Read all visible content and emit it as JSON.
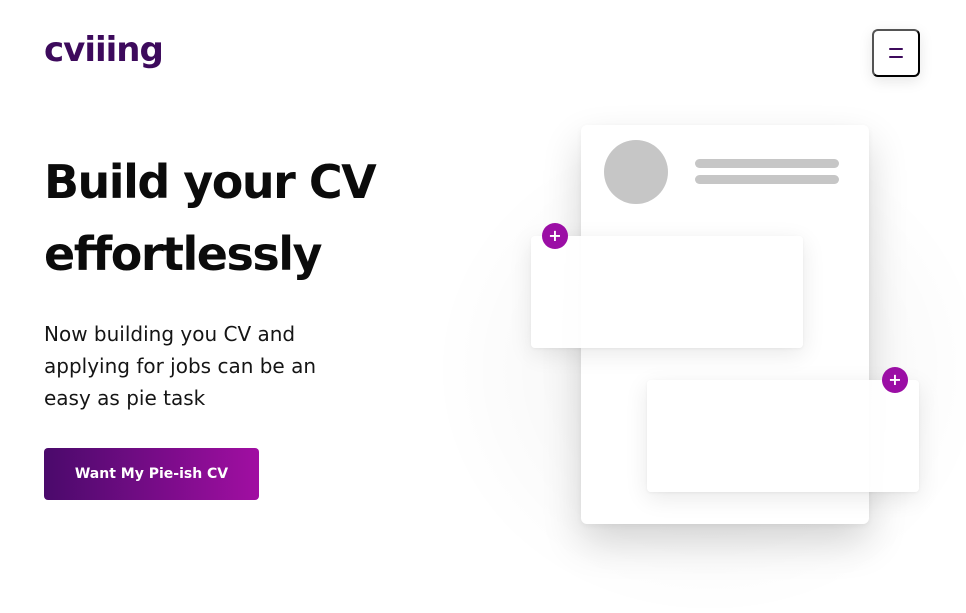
{
  "header": {
    "logo_text": "cviiing",
    "menu_icon": "hamburger-menu-icon"
  },
  "hero": {
    "title": "Build your CV effortlessly",
    "subtitle": "Now building you CV and applying for jobs can be an easy as pie task",
    "cta_label": "Want My Pie-ish CV"
  },
  "illustration": {
    "add_icon": "+",
    "add_icon_name": "plus-icon"
  },
  "colors": {
    "brand": "#3d0a5c",
    "accent": "#a10ea2",
    "placeholder_gray": "#c6c6c6"
  }
}
